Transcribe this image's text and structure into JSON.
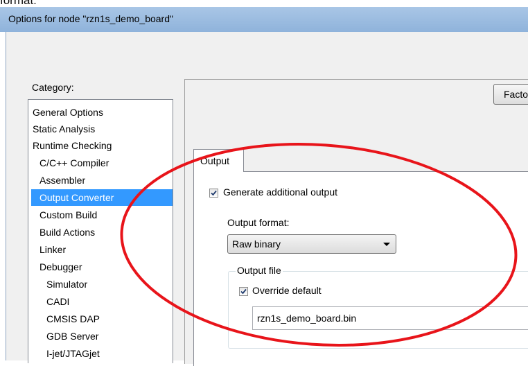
{
  "pretext": "format:",
  "window": {
    "title": "Options for node \"rzn1s_demo_board\""
  },
  "category": {
    "label": "Category:",
    "items": [
      {
        "label": "General Options",
        "indent": 0
      },
      {
        "label": "Static Analysis",
        "indent": 0
      },
      {
        "label": "Runtime Checking",
        "indent": 0
      },
      {
        "label": "C/C++ Compiler",
        "indent": 1
      },
      {
        "label": "Assembler",
        "indent": 1
      },
      {
        "label": "Output Converter",
        "indent": 1,
        "selected": true
      },
      {
        "label": "Custom Build",
        "indent": 1
      },
      {
        "label": "Build Actions",
        "indent": 1
      },
      {
        "label": "Linker",
        "indent": 1
      },
      {
        "label": "Debugger",
        "indent": 1
      },
      {
        "label": "Simulator",
        "indent": 2
      },
      {
        "label": "CADI",
        "indent": 2
      },
      {
        "label": "CMSIS DAP",
        "indent": 2
      },
      {
        "label": "GDB Server",
        "indent": 2
      },
      {
        "label": "I-jet/JTAGjet",
        "indent": 2
      }
    ]
  },
  "factory_button": {
    "label": "Factory Settings"
  },
  "tabs": [
    {
      "label": "Output"
    }
  ],
  "output": {
    "generate_checkbox": {
      "label": "Generate additional output",
      "checked": true
    },
    "format_label": "Output format:",
    "format_value": "Raw binary",
    "file_group_label": "Output file",
    "override_checkbox": {
      "label": "Override default",
      "checked": true
    },
    "file_name": "rzn1s_demo_board.bin"
  },
  "annotation": {
    "color": "#e8141a"
  }
}
